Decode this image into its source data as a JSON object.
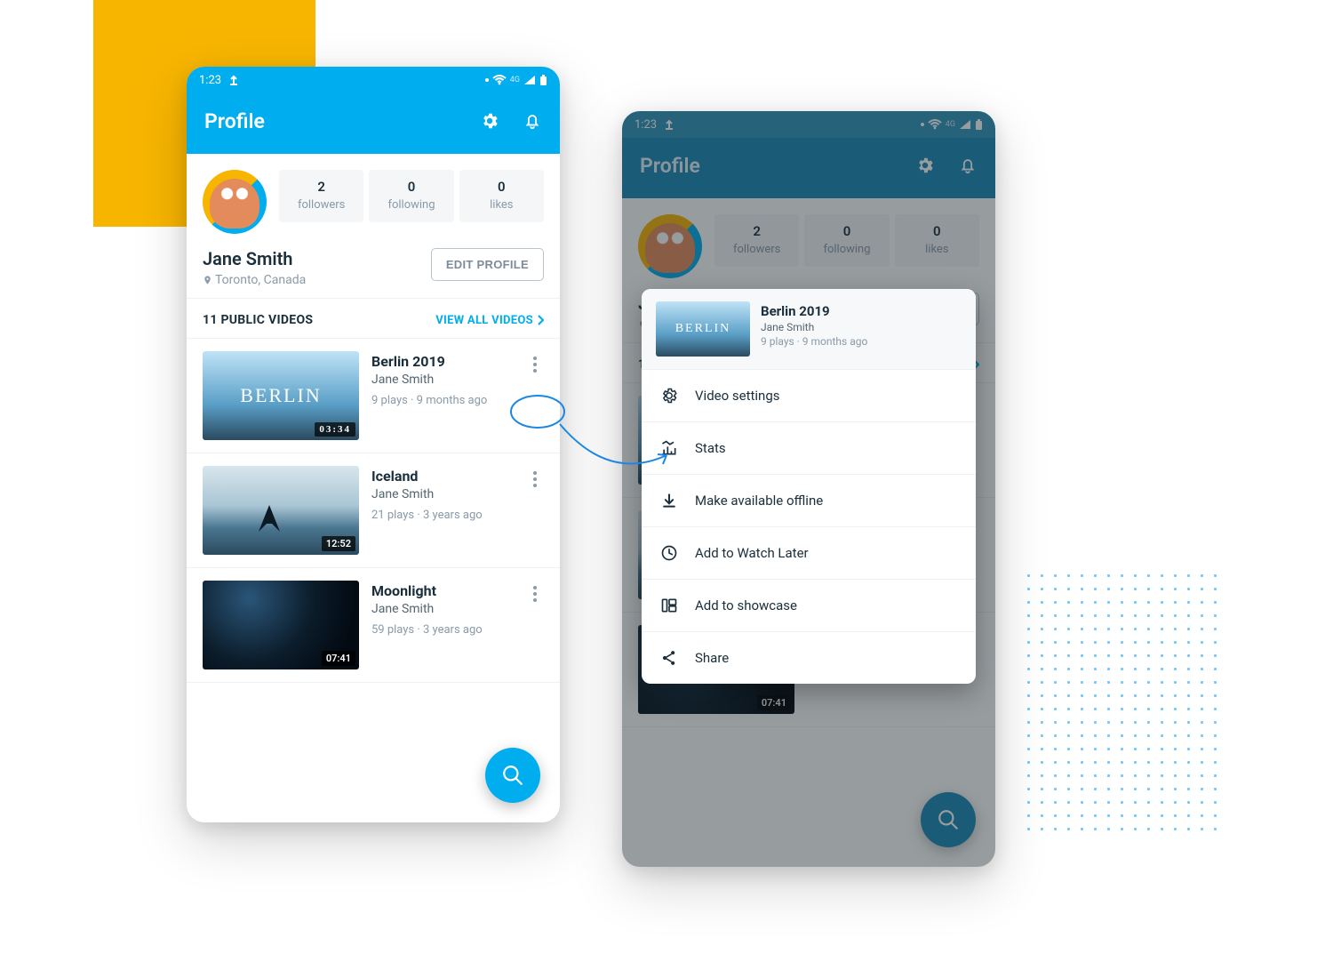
{
  "status": {
    "time": "1:23",
    "network": "4G"
  },
  "appbar": {
    "title": "Profile"
  },
  "profile": {
    "stats": [
      {
        "value": "2",
        "label": "followers"
      },
      {
        "value": "0",
        "label": "following"
      },
      {
        "value": "0",
        "label": "likes"
      }
    ],
    "name": "Jane Smith",
    "location": "Toronto, Canada",
    "edit_label": "EDIT PROFILE"
  },
  "section": {
    "count_label": "11 PUBLIC VIDEOS",
    "view_all": "VIEW ALL VIDEOS"
  },
  "videos": [
    {
      "title": "Berlin 2019",
      "author": "Jane Smith",
      "meta": "9 plays · 9 months ago",
      "duration": "03:34",
      "thumb_text": "BERLIN"
    },
    {
      "title": "Iceland",
      "author": "Jane Smith",
      "meta": "21 plays · 3 years ago",
      "duration": "12:52"
    },
    {
      "title": "Moonlight",
      "author": "Jane Smith",
      "meta": "59 plays · 3 years ago",
      "duration": "07:41"
    }
  ],
  "sheet": {
    "header": {
      "title": "Berlin 2019",
      "author": "Jane Smith",
      "meta": "9 plays · 9 months ago",
      "thumb_text": "BERLIN"
    },
    "items": [
      {
        "label": "Video settings"
      },
      {
        "label": "Stats"
      },
      {
        "label": "Make available offline"
      },
      {
        "label": "Add to Watch Later"
      },
      {
        "label": "Add to showcase"
      },
      {
        "label": "Share"
      }
    ]
  }
}
